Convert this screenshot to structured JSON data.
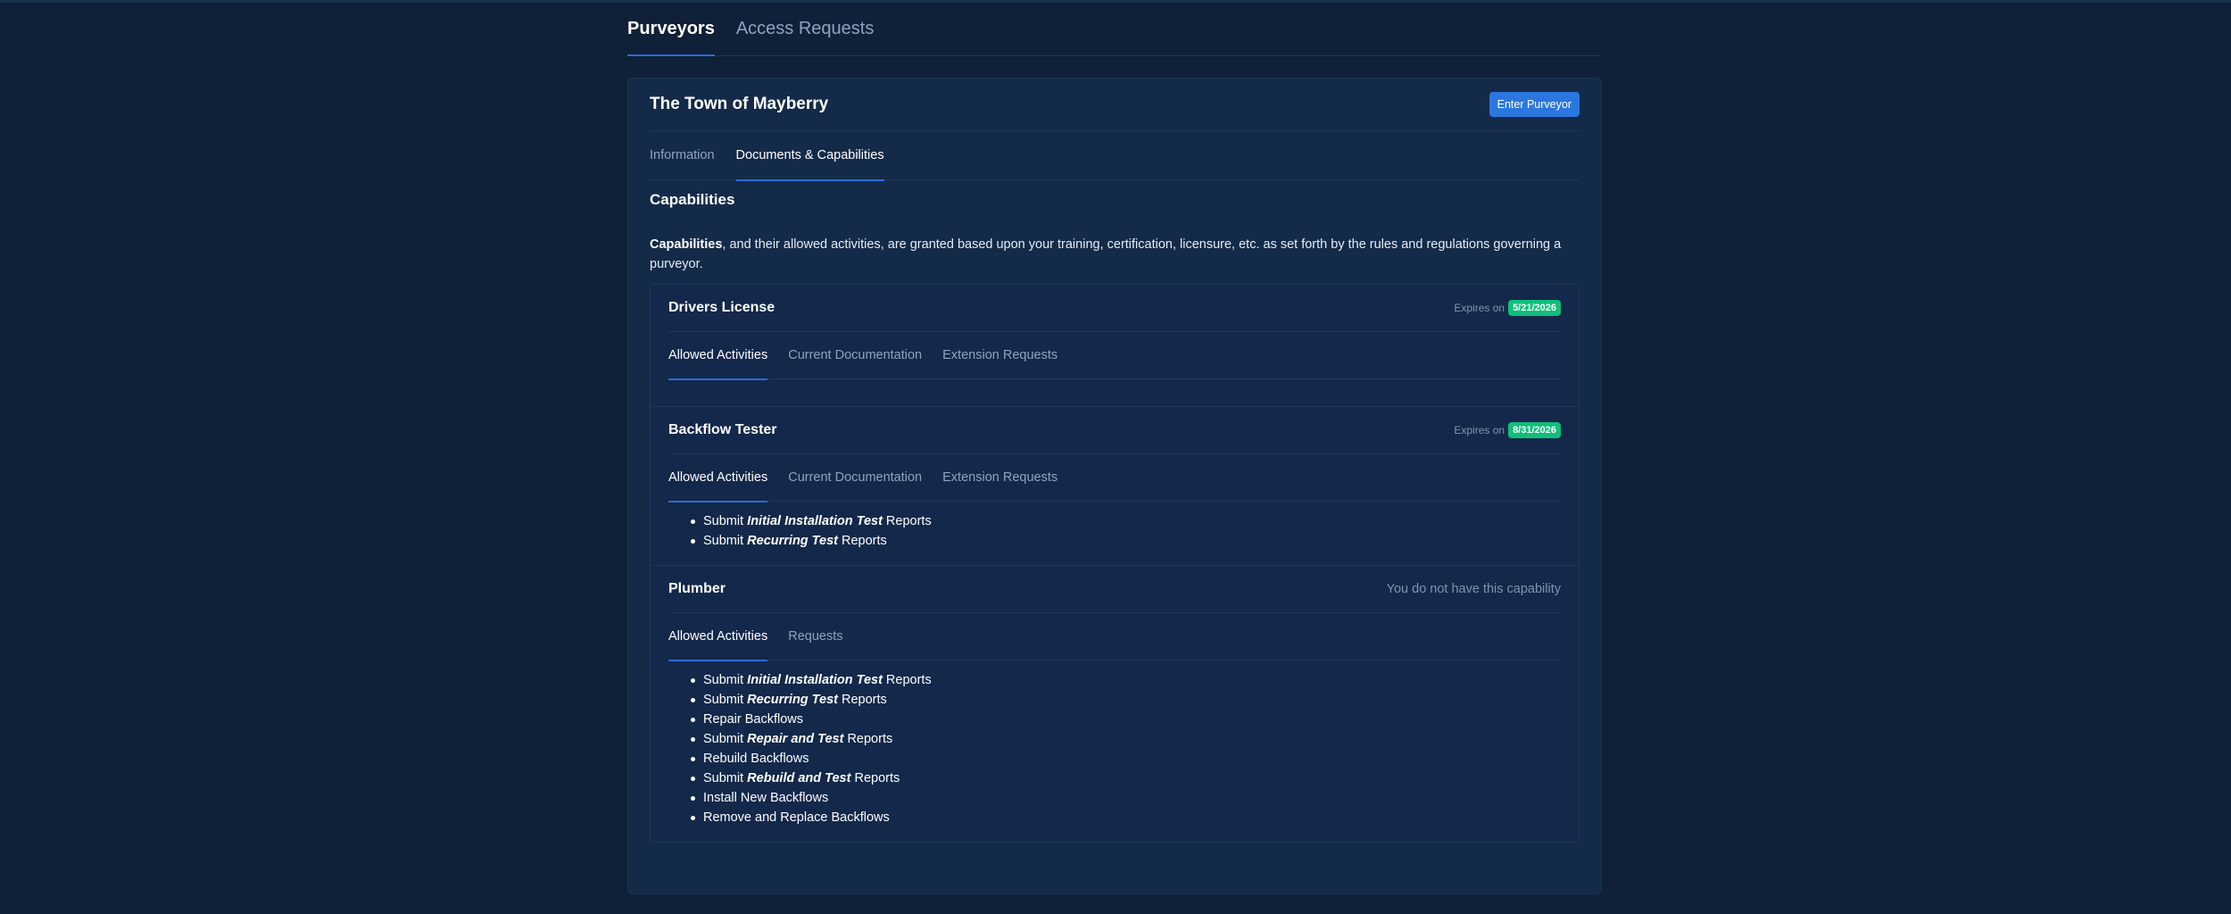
{
  "main_tabs": [
    {
      "label": "Purveyors",
      "active": true
    },
    {
      "label": "Access Requests",
      "active": false
    }
  ],
  "card": {
    "title": "The Town of Mayberry",
    "enter_button": "Enter Purveyor",
    "tabs": [
      {
        "label": "Information",
        "active": false
      },
      {
        "label": "Documents & Capabilities",
        "active": true
      }
    ]
  },
  "capabilities": {
    "title": "Capabilities",
    "intro_bold": "Capabilities",
    "intro_rest": ", and their allowed activities, are granted based upon your training, certification, licensure, etc. as set forth by the rules and regulations governing a purveyor.",
    "items": [
      {
        "name": "Drivers License",
        "expires_label": "Expires on",
        "expires_date": "5/21/2026",
        "tabs": [
          "Allowed Activities",
          "Current Documentation",
          "Extension Requests"
        ],
        "activities": []
      },
      {
        "name": "Backflow Tester",
        "expires_label": "Expires on",
        "expires_date": "8/31/2026",
        "tabs": [
          "Allowed Activities",
          "Current Documentation",
          "Extension Requests"
        ],
        "activities": [
          {
            "pre": "Submit ",
            "em": "Initial Installation Test",
            "post": " Reports"
          },
          {
            "pre": "Submit ",
            "em": "Recurring Test",
            "post": " Reports"
          }
        ]
      },
      {
        "name": "Plumber",
        "status": "You do not have this capability",
        "tabs": [
          "Allowed Activities",
          "Requests"
        ],
        "activities": [
          {
            "pre": "Submit ",
            "em": "Initial Installation Test",
            "post": " Reports"
          },
          {
            "pre": "Submit ",
            "em": "Recurring Test",
            "post": " Reports"
          },
          {
            "pre": "Repair Backflows",
            "em": "",
            "post": ""
          },
          {
            "pre": "Submit ",
            "em": "Repair and Test",
            "post": " Reports"
          },
          {
            "pre": "Rebuild Backflows",
            "em": "",
            "post": ""
          },
          {
            "pre": "Submit ",
            "em": "Rebuild and Test",
            "post": " Reports"
          },
          {
            "pre": "Install New Backflows",
            "em": "",
            "post": ""
          },
          {
            "pre": "Remove and Replace Backflows",
            "em": "",
            "post": ""
          }
        ]
      }
    ]
  },
  "colors": {
    "background": "#0f2038",
    "card": "#142a49",
    "accent": "#2b77df",
    "badge": "#0fbf7a"
  }
}
